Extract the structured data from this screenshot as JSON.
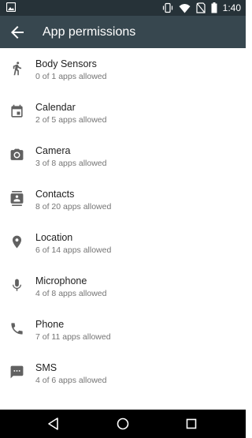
{
  "status_bar": {
    "time": "1:40",
    "icons": [
      "gallery-icon",
      "vibrate-icon",
      "wifi-icon",
      "sim-off-icon",
      "battery-icon"
    ]
  },
  "app_bar": {
    "title": "App permissions",
    "back_icon": "arrow-back-icon"
  },
  "permissions": [
    {
      "name": "Body Sensors",
      "status": "0 of 1 apps allowed",
      "icon": "walk-icon"
    },
    {
      "name": "Calendar",
      "status": "2 of 5 apps allowed",
      "icon": "calendar-icon"
    },
    {
      "name": "Camera",
      "status": "3 of 8 apps allowed",
      "icon": "camera-icon"
    },
    {
      "name": "Contacts",
      "status": "8 of 20 apps allowed",
      "icon": "contacts-icon"
    },
    {
      "name": "Location",
      "status": "6 of 14 apps allowed",
      "icon": "location-icon"
    },
    {
      "name": "Microphone",
      "status": "4 of 8 apps allowed",
      "icon": "microphone-icon"
    },
    {
      "name": "Phone",
      "status": "7 of 11 apps allowed",
      "icon": "phone-icon"
    },
    {
      "name": "SMS",
      "status": "4 of 6 apps allowed",
      "icon": "sms-icon"
    }
  ],
  "colors": {
    "status_bar": "#263238",
    "app_bar": "#37474f",
    "icon": "#616161",
    "primary_text": "#212121",
    "secondary_text": "#757575",
    "nav_bar": "#000000"
  },
  "nav_bar": {
    "icons": [
      "back-triangle-icon",
      "home-circle-icon",
      "recents-square-icon"
    ]
  }
}
